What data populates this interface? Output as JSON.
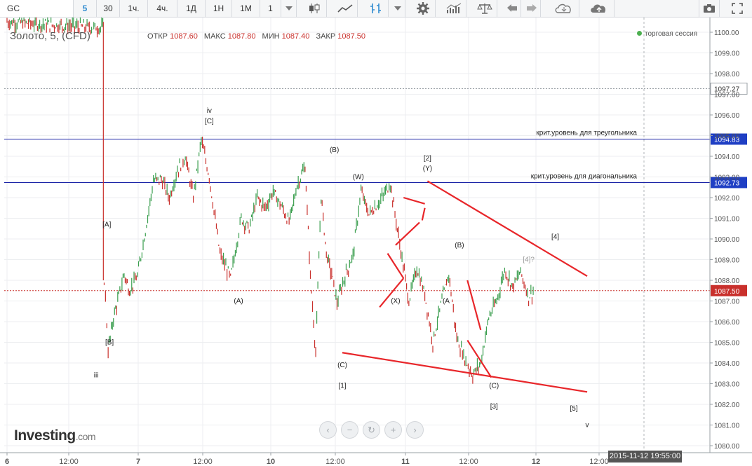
{
  "toolbar": {
    "symbol": "GC",
    "intervals": [
      "5",
      "30",
      "1ч.",
      "4ч.",
      "1Д",
      "1Н",
      "1М"
    ],
    "active_interval": "5",
    "multiplier": "1",
    "icons": [
      "candlestick-icon",
      "area-icon",
      "bars-icon",
      "settings-gear-icon",
      "indicators-icon",
      "scales-icon",
      "undo-icon",
      "redo-icon",
      "cloud-load-icon",
      "cloud-save-icon",
      "camera-icon",
      "fullscreen-icon"
    ]
  },
  "legend": {
    "title": "Золото, 5, (CFD)",
    "open_label": "ОТКР",
    "open": "1087.60",
    "high_label": "МАКС",
    "high": "1087.80",
    "low_label": "МИН",
    "low": "1087.40",
    "close_label": "ЗАКР",
    "close": "1087.50",
    "session": "торговая сессия"
  },
  "branding": {
    "logo": "Investing",
    "domain": ".com"
  },
  "nav": [
    "‹",
    "−",
    "↻",
    "+",
    "›"
  ],
  "time_badge": "2015-11-12 19:55:00",
  "colors": {
    "up": "#3a9e4e",
    "down": "#c9302c",
    "level_line": "#1a23a6",
    "pattern": "#e8262a",
    "price_badge": "#c9302c",
    "level_badge": "#1f3fc4"
  },
  "chart_data": {
    "type": "line",
    "instrument": "Золото, 5, (CFD)",
    "ylim": [
      1080,
      1100
    ],
    "y_ticks": [
      "1080.00",
      "1081.00",
      "1082.00",
      "1083.00",
      "1084.00",
      "1085.00",
      "1086.00",
      "1087.00",
      "1088.00",
      "1089.00",
      "1090.00",
      "1091.00",
      "1092.00",
      "1093.00",
      "1094.00",
      "1095.00",
      "1096.00",
      "1097.00",
      "1098.00",
      "1099.00",
      "1100.00"
    ],
    "x_labels": [
      "6",
      "12:00",
      "7",
      "12:00",
      "10",
      "12:00",
      "11",
      "12:00",
      "12",
      "12:00"
    ],
    "series": [
      {
        "x": [
          0.0,
          3.6,
          3.65,
          3.7,
          3.8,
          4.0,
          4.2,
          4.4,
          4.6,
          4.9,
          5.2,
          5.5,
          5.8,
          6.1,
          6.4,
          6.7,
          7.0,
          7.3,
          7.6,
          8.0,
          8.4,
          8.8,
          9.1,
          9.4,
          9.7,
          10.0,
          10.3,
          10.6,
          10.9,
          11.2,
          11.4,
          11.6,
          11.8,
          12.0,
          12.2,
          12.4,
          12.7,
          13.0,
          13.3,
          13.6,
          14.0,
          14.4,
          14.8,
          15.1,
          15.4,
          15.7,
          16.0,
          16.3,
          16.6,
          16.9,
          17.2,
          17.5,
          17.8,
          18.1,
          18.4,
          18.7,
          19.0,
          19.3,
          19.6,
          19.9,
          20.2,
          20.5,
          20.8,
          21.1,
          21.4,
          21.7,
          22.0
        ],
        "y": [
          1100.5,
          1100.2,
          1088.0,
          1087.2,
          1084.6,
          1086.2,
          1087.2,
          1088.3,
          1087.5,
          1088.2,
          1090.4,
          1092.8,
          1092.9,
          1092.0,
          1093.3,
          1094.0,
          1092.0,
          1094.8,
          1093.0,
          1089.3,
          1088.1,
          1091.0,
          1090.5,
          1092.0,
          1091.5,
          1092.3,
          1091.6,
          1090.8,
          1092.6,
          1093.5,
          1088.2,
          1084.5,
          1092.1,
          1089.3,
          1088.3,
          1086.9,
          1088.2,
          1089.2,
          1092.3,
          1091.2,
          1091.8,
          1092.7,
          1089.4,
          1087.0,
          1088.6,
          1087.3,
          1085.0,
          1086.8,
          1088.3,
          1085.2,
          1084.2,
          1083.4,
          1084.0,
          1086.2,
          1087.0,
          1088.5,
          1087.7,
          1088.4,
          1087.2,
          1087.6,
          1087.5,
          1087.5,
          1087.5,
          1087.5,
          1087.5,
          1087.5,
          1087.5
        ],
        "name": ""
      }
    ],
    "current_price": "1087.50",
    "horizontal_levels": [
      {
        "value": "1097.27",
        "label": "",
        "style": "dotted"
      },
      {
        "value": "1094.83",
        "label": "крит.уровень для треугольника",
        "style": "solid"
      },
      {
        "value": "1092.73",
        "label": "крит.уровень для диагональника",
        "style": "solid"
      }
    ],
    "annotations": [
      {
        "text": "iv",
        "x": 7.6,
        "y": 1096.1
      },
      {
        "text": "[C]",
        "x": 7.6,
        "y": 1095.6
      },
      {
        "text": "[A]",
        "x": 3.75,
        "y": 1090.6
      },
      {
        "text": "[B]",
        "x": 3.85,
        "y": 1084.9
      },
      {
        "text": "iii",
        "x": 3.35,
        "y": 1083.3
      },
      {
        "text": "(A)",
        "x": 8.7,
        "y": 1086.9
      },
      {
        "text": "(B)",
        "x": 12.3,
        "y": 1094.2
      },
      {
        "text": "(W)",
        "x": 13.2,
        "y": 1092.9
      },
      {
        "text": "(X)",
        "x": 14.6,
        "y": 1086.9
      },
      {
        "text": "[2]",
        "x": 15.8,
        "y": 1093.8
      },
      {
        "text": "(Y)",
        "x": 15.8,
        "y": 1093.3
      },
      {
        "text": "(C)",
        "x": 12.6,
        "y": 1083.8
      },
      {
        "text": "[1]",
        "x": 12.6,
        "y": 1082.8
      },
      {
        "text": "(B)",
        "x": 17.0,
        "y": 1089.6
      },
      {
        "text": "(A",
        "x": 16.5,
        "y": 1086.9
      },
      {
        "text": "(C)",
        "x": 18.3,
        "y": 1082.8
      },
      {
        "text": "[3]",
        "x": 18.3,
        "y": 1081.8
      },
      {
        "text": "[4]?",
        "x": 19.6,
        "y": 1088.9
      },
      {
        "text": "[4]",
        "x": 20.6,
        "y": 1090.0
      },
      {
        "text": "[5]",
        "x": 21.3,
        "y": 1081.7
      },
      {
        "text": "v",
        "x": 21.8,
        "y": 1080.9
      }
    ]
  }
}
